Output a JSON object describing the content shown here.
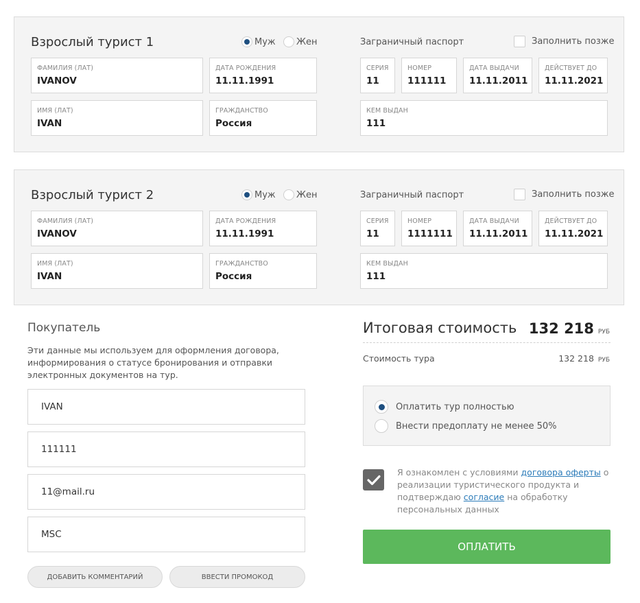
{
  "tourists": [
    {
      "title": "Взрослый турист 1",
      "gender": {
        "male": "Муж",
        "female": "Жен",
        "selected": "male"
      },
      "last_name": {
        "label": "Фамилия (лат)",
        "value": "IVANOV"
      },
      "birth_date": {
        "label": "Дата рождения",
        "value": "11.11.1991"
      },
      "first_name": {
        "label": "Имя (лат)",
        "value": "IVAN"
      },
      "citizenship": {
        "label": "Гражданство",
        "value": "Россия"
      },
      "passport": {
        "title": "Заграничный паспорт",
        "fill_later": "Заполнить позже",
        "series": {
          "label": "Серия",
          "value": "11"
        },
        "number": {
          "label": "Номер",
          "value": "111111"
        },
        "issue_date": {
          "label": "Дата выдачи",
          "value": "11.11.2011"
        },
        "valid_until": {
          "label": "Действует до",
          "value": "11.11.2021"
        },
        "issued_by": {
          "label": "Кем выдан",
          "value": "111"
        }
      }
    },
    {
      "title": "Взрослый турист 2",
      "gender": {
        "male": "Муж",
        "female": "Жен",
        "selected": "male"
      },
      "last_name": {
        "label": "Фамилия (лат)",
        "value": "IVANOV"
      },
      "birth_date": {
        "label": "Дата рождения",
        "value": "11.11.1991"
      },
      "first_name": {
        "label": "Имя (лат)",
        "value": "IVAN"
      },
      "citizenship": {
        "label": "Гражданство",
        "value": "Россия"
      },
      "passport": {
        "title": "Заграничный паспорт",
        "fill_later": "Заполнить позже",
        "series": {
          "label": "Серия",
          "value": "11"
        },
        "number": {
          "label": "Номер",
          "value": "1111111"
        },
        "issue_date": {
          "label": "Дата выдачи",
          "value": "11.11.2011"
        },
        "valid_until": {
          "label": "Действует до",
          "value": "11.11.2021"
        },
        "issued_by": {
          "label": "Кем выдан",
          "value": "111"
        }
      }
    }
  ],
  "buyer": {
    "title": "Покупатель",
    "description": "Эти данные мы используем для оформления договора, информирования о статусе бронирования и отправки электронных документов на тур.",
    "name": "IVAN",
    "phone": "111111",
    "email": "11@mail.ru",
    "city": "MSC",
    "add_comment": "Добавить комментарий",
    "promo_code": "Ввести промокод"
  },
  "summary": {
    "total_label": "Итоговая стоимость",
    "total_amount": "132 218",
    "currency": "руб",
    "tour_cost_label": "Стоимость тура",
    "tour_cost_amount": "132 218",
    "pay_full": "Оплатить тур полностью",
    "pay_partial": "Внести предоплату не менее 50%",
    "agree_prefix": "Я ознакомлен с условиями ",
    "agree_link1": "договора оферты",
    "agree_middle": " о реализации туристического продукта и подтверждаю ",
    "agree_link2": "согласие",
    "agree_suffix": " на обработку персональных данных",
    "pay_button": "Оплатить"
  },
  "colors": {
    "radio_selected": "#1e4f80",
    "pay_button": "#5cb85c",
    "link": "#2b7bb9",
    "checkbox_checked": "#666666"
  }
}
